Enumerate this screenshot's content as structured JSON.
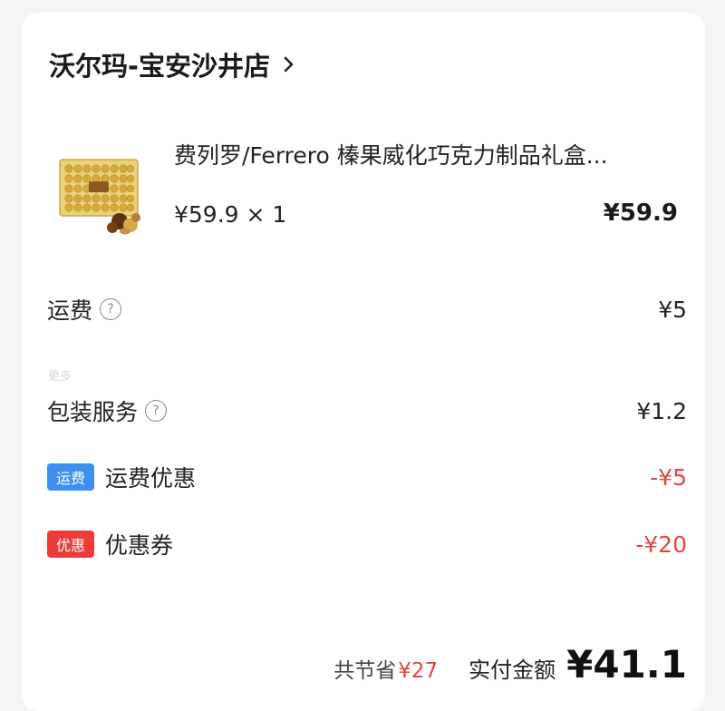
{
  "store": {
    "name": "沃尔玛-宝安沙井店",
    "chevron_icon": "chevron-right-icon"
  },
  "product": {
    "image_icon": "ferrero-chocolate-box-image",
    "name": "费列罗/Ferrero 榛果威化巧克力制品礼盒...",
    "unit_price_qty": "¥59.9 × 1",
    "total": "¥59.9"
  },
  "fees": {
    "shipping": {
      "label": "运费",
      "value": "¥5",
      "help_icon": "question-circle-icon"
    },
    "more": "更多",
    "packaging": {
      "label": "包装服务",
      "value": "¥1.2",
      "help_icon": "question-circle-icon"
    }
  },
  "discounts": {
    "shipping_discount": {
      "tag": "运费",
      "label": "运费优惠",
      "value": "-¥5",
      "tag_color": "#3d8ff0"
    },
    "coupon": {
      "tag": "优惠",
      "label": "优惠券",
      "value": "-¥20",
      "tag_color": "#ea3d3a"
    }
  },
  "summary": {
    "saved_label": "共节省",
    "saved_amount": "¥27",
    "paid_label": "实付金额",
    "paid_amount": "¥41.1"
  },
  "colors": {
    "discount_red": "#e8443f",
    "page_bg": "#f4f4f4",
    "card_bg": "#ffffff"
  }
}
